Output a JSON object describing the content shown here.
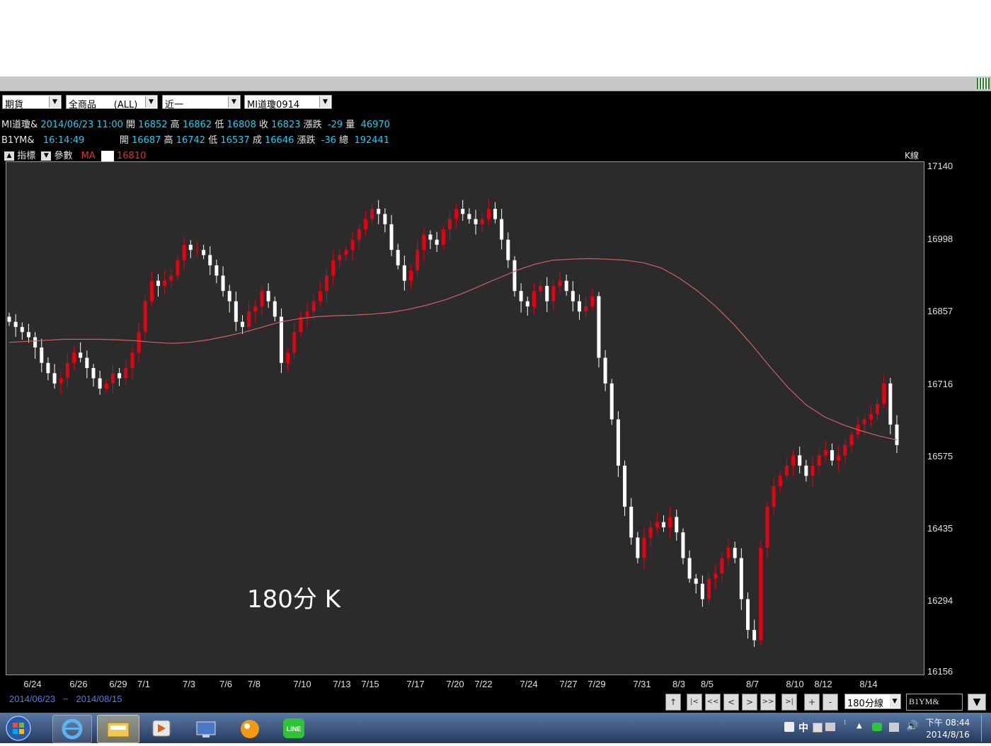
{
  "toolbar": {
    "market": "期貨",
    "product": "全商品      (ALL)",
    "period": "近一",
    "symbol": "MI道瓊0914"
  },
  "quote1": {
    "symbol": "MI道瓊&",
    "datetime": "2014/06/23 11:00",
    "open_label": "開",
    "open": "16852",
    "high_label": "高",
    "high": "16862",
    "low_label": "低",
    "low": "16808",
    "close_label": "收",
    "close": "16823",
    "change_label": "漲跌",
    "change": "-29",
    "volume_label": "量",
    "volume": "46970"
  },
  "quote2": {
    "symbol": "B1YM&",
    "time": "16:14:49",
    "open_label": "開",
    "open": "16687",
    "high_label": "高",
    "high": "16742",
    "low_label": "低",
    "low": "16537",
    "close_label": "成",
    "close": "16646",
    "change_label": "漲跌",
    "change": "-36",
    "volume_label": "總",
    "volume": "192441"
  },
  "indicator": {
    "indicator_label": "指標",
    "param_label": "參數",
    "ma_label": "MA",
    "ma_value": "16810",
    "kline_label": "K線"
  },
  "watermark": "180分 K",
  "date_range": {
    "from": "2014/06/23",
    "sep": "~",
    "to": "2014/08/15"
  },
  "bottom": {
    "nav_buttons": [
      "↑",
      "|<",
      "<<",
      "<",
      ">",
      ">>",
      ">|",
      "+",
      "-"
    ],
    "interval": "180分線",
    "symbol_input": "B1YM&"
  },
  "clock": {
    "time": "下午 08:44",
    "date": "2014/8/16"
  },
  "tray_ime": "中",
  "colors": {
    "up": "#e60012",
    "down": "#ffffff",
    "ma": "#d06060",
    "info_cyan": "#22ccee",
    "bg": "#2b2b2b"
  },
  "chart_data": {
    "type": "candlestick",
    "title": "",
    "ylim": [
      16156,
      17140
    ],
    "y_ticks": [
      17140,
      16998,
      16857,
      16716,
      16575,
      16435,
      16294,
      16156
    ],
    "x_ticks": [
      "6/24",
      "6/26",
      "6/29",
      "7/1",
      "7/3",
      "7/6",
      "7/8",
      "7/10",
      "7/13",
      "7/15",
      "7/17",
      "7/20",
      "7/22",
      "7/24",
      "7/27",
      "7/29",
      "7/31",
      "8/3",
      "8/5",
      "8/7",
      "8/10",
      "8/12",
      "8/14"
    ],
    "close_series": [
      16840,
      16830,
      16820,
      16810,
      16790,
      16760,
      16740,
      16720,
      16730,
      16760,
      16780,
      16770,
      16750,
      16730,
      16710,
      16720,
      16740,
      16730,
      16750,
      16780,
      16820,
      16880,
      16920,
      16910,
      16920,
      16930,
      16960,
      16990,
      16980,
      16980,
      16970,
      16950,
      16930,
      16900,
      16880,
      16840,
      16830,
      16860,
      16870,
      16900,
      16880,
      16850,
      16760,
      16780,
      16820,
      16850,
      16860,
      16880,
      16900,
      16930,
      16960,
      16970,
      16980,
      17000,
      17020,
      17040,
      17060,
      17050,
      17030,
      16980,
      16950,
      16920,
      16940,
      16980,
      17010,
      17000,
      16990,
      17020,
      17040,
      17060,
      17050,
      17040,
      17030,
      17040,
      17060,
      17040,
      17000,
      16960,
      16900,
      16880,
      16870,
      16900,
      16910,
      16880,
      16910,
      16920,
      16900,
      16880,
      16860,
      16870,
      16890,
      16770,
      16720,
      16650,
      16560,
      16480,
      16420,
      16380,
      16420,
      16440,
      16450,
      16440,
      16460,
      16430,
      16380,
      16340,
      16330,
      16300,
      16340,
      16350,
      16380,
      16400,
      16380,
      16300,
      16240,
      16220,
      16400,
      16480,
      16520,
      16540,
      16560,
      16580,
      16560,
      16540,
      16560,
      16580,
      16590,
      16570,
      16580,
      16600,
      16620,
      16640,
      16650,
      16660,
      16680,
      16720,
      16640,
      16600
    ],
    "ma_series": [
      16800,
      16802,
      16804,
      16806,
      16806,
      16806,
      16805,
      16803,
      16800,
      16798,
      16800,
      16805,
      16812,
      16820,
      16830,
      16840,
      16846,
      16850,
      16852,
      16853,
      16855,
      16858,
      16864,
      16872,
      16882,
      16895,
      16910,
      16925,
      16940,
      16952,
      16960,
      16962,
      16963,
      16962,
      16960,
      16955,
      16945,
      16925,
      16900,
      16870,
      16835,
      16795,
      16752,
      16712,
      16678,
      16655,
      16640,
      16628,
      16618,
      16610
    ]
  }
}
